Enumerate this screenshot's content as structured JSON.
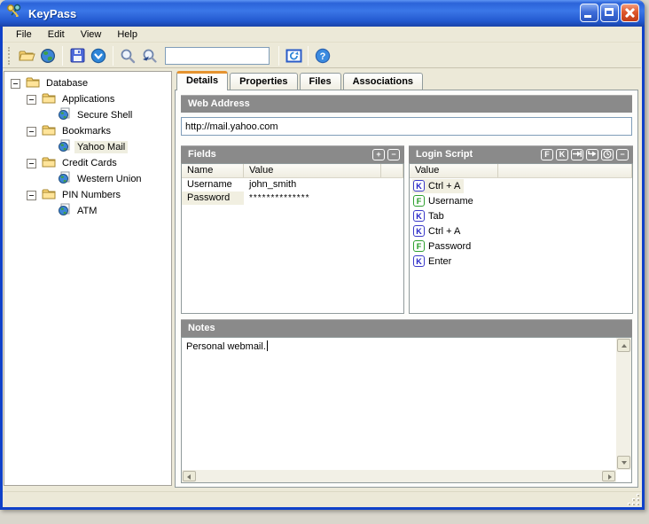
{
  "window": {
    "title": "KeyPass"
  },
  "menu": {
    "items": [
      {
        "label": "File"
      },
      {
        "label": "Edit"
      },
      {
        "label": "View"
      },
      {
        "label": "Help"
      }
    ]
  },
  "toolbar": {
    "search_value": ""
  },
  "tree": {
    "items": [
      {
        "label": "Database"
      },
      {
        "label": "Applications"
      },
      {
        "label": "Secure Shell"
      },
      {
        "label": "Bookmarks"
      },
      {
        "label": "Yahoo Mail"
      },
      {
        "label": "Credit Cards"
      },
      {
        "label": "Western Union"
      },
      {
        "label": "PIN Numbers"
      },
      {
        "label": "ATM"
      }
    ]
  },
  "tabs": {
    "items": [
      {
        "label": "Details"
      },
      {
        "label": "Properties"
      },
      {
        "label": "Files"
      },
      {
        "label": "Associations"
      }
    ]
  },
  "details": {
    "web_address": {
      "title": "Web Address",
      "value": "http://mail.yahoo.com"
    },
    "fields": {
      "title": "Fields",
      "buttons": {
        "add": "+",
        "remove": "−"
      },
      "columns": {
        "name": "Name",
        "value": "Value"
      },
      "rows": [
        {
          "name": "Username",
          "value": "john_smith"
        },
        {
          "name": "Password",
          "value": "**************"
        }
      ]
    },
    "login_script": {
      "title": "Login Script",
      "buttons": {
        "field": "F",
        "key": "K",
        "remove": "−"
      },
      "columns": {
        "value": "Value"
      },
      "rows": [
        {
          "icon": "K",
          "label": "Ctrl + A"
        },
        {
          "icon": "F",
          "label": "Username"
        },
        {
          "icon": "K",
          "label": "Tab"
        },
        {
          "icon": "K",
          "label": "Ctrl + A"
        },
        {
          "icon": "F",
          "label": "Password"
        },
        {
          "icon": "K",
          "label": "Enter"
        }
      ]
    },
    "notes": {
      "title": "Notes",
      "value": "Personal webmail."
    }
  },
  "icons": {
    "help_glyph": "?"
  },
  "colors": {
    "titlebar": "#2B63D9",
    "header_gray": "#8A8A8A",
    "key_blue": "#2424C8",
    "field_green": "#1E9A1E",
    "tab_accent": "#E5932F",
    "window_border": "#0F41C9"
  }
}
